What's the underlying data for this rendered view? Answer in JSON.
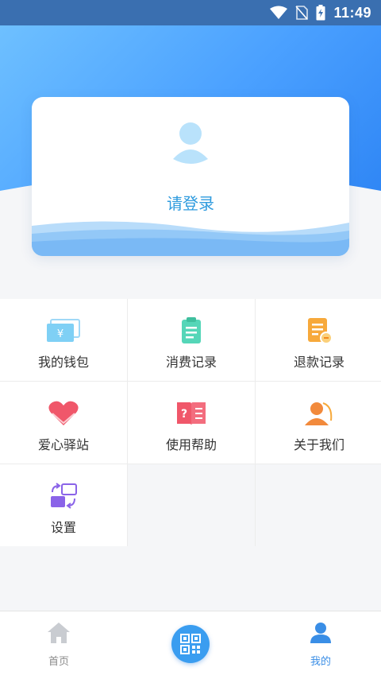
{
  "status_bar": {
    "time": "11:49",
    "icons": [
      "wifi-icon",
      "no-sim-icon",
      "battery-charging-icon"
    ]
  },
  "profile_card": {
    "avatar_icon": "user-avatar-icon",
    "login_label": "请登录"
  },
  "menu": {
    "items": [
      {
        "label": "我的钱包",
        "icon": "wallet-icon"
      },
      {
        "label": "消费记录",
        "icon": "clipboard-icon"
      },
      {
        "label": "退款记录",
        "icon": "refund-document-icon"
      },
      {
        "label": "爱心驿站",
        "icon": "heart-icon"
      },
      {
        "label": "使用帮助",
        "icon": "help-book-icon"
      },
      {
        "label": "关于我们",
        "icon": "about-us-icon"
      },
      {
        "label": "设置",
        "icon": "settings-icon"
      }
    ]
  },
  "tab_bar": {
    "home_label": "首页",
    "home_icon": "home-icon",
    "scan_icon": "qr-code-icon",
    "mine_label": "我的",
    "mine_icon": "person-icon",
    "active_tab": "我的"
  },
  "colors": {
    "hero_start": "#6ec0ff",
    "hero_end": "#2f86f5",
    "login_text": "#2f9bde",
    "active_tab": "#3a8ee6",
    "inactive_tab": "#8a8a8a"
  }
}
